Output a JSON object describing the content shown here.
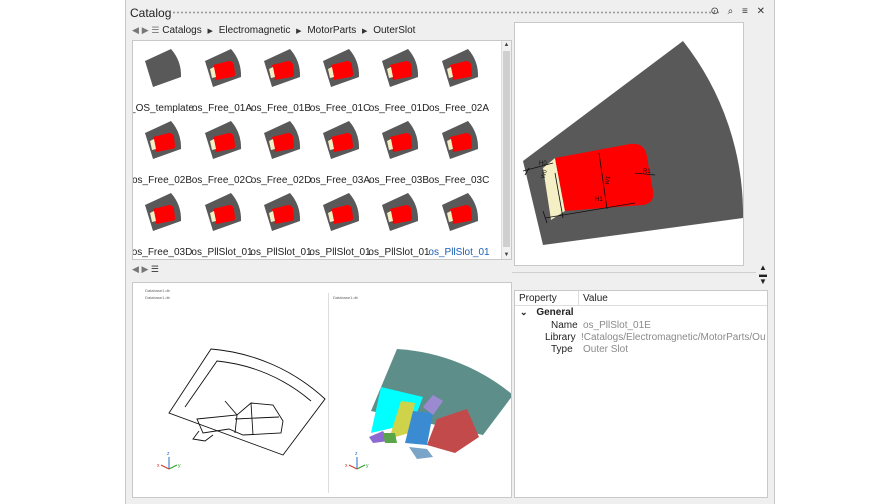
{
  "window": {
    "title": "Catalog",
    "buttons": "⊙ ⌕ ≡ ✕"
  },
  "breadcrumb": [
    "Catalogs",
    "Electromagnetic",
    "MotorParts",
    "OuterSlot"
  ],
  "nav": {
    "back": "◀",
    "forward": "▶",
    "list": "☰"
  },
  "thumbnails": [
    "_OS_template",
    "os_Free_01A",
    "os_Free_01B",
    "os_Free_01C",
    "os_Free_01D",
    "os_Free_02A",
    "os_Free_02B",
    "os_Free_02C",
    "os_Free_02D",
    "os_Free_03A",
    "os_Free_03B",
    "os_Free_03C",
    "os_Free_03D",
    "os_PllSlot_01",
    "os_PllSlot_01",
    "os_PllSlot_01",
    "os_PllSlot_01",
    "os_PllSlot_01"
  ],
  "selected_index": 17,
  "preview_dims": [
    "H0",
    "W0",
    "W1",
    "H1",
    "R1"
  ],
  "viewer": {
    "tree_label": "Database1.db",
    "left_tab": "Database1.db",
    "right_tab": "Database1.db",
    "axis_x": "x",
    "axis_y": "y",
    "axis_z": "z"
  },
  "properties": {
    "col_property": "Property",
    "col_value": "Value",
    "group": "General",
    "rows": [
      {
        "key": "Name",
        "value": "os_PllSlot_01E"
      },
      {
        "key": "Library",
        "value": "!Catalogs/Electromagnetic/MotorParts/OuterSlot"
      },
      {
        "key": "Type",
        "value": "Outer Slot"
      }
    ]
  },
  "colors": {
    "slot_red": "#ff0000",
    "stator_gray": "#595959",
    "selected_text": "#1a5fb4"
  }
}
